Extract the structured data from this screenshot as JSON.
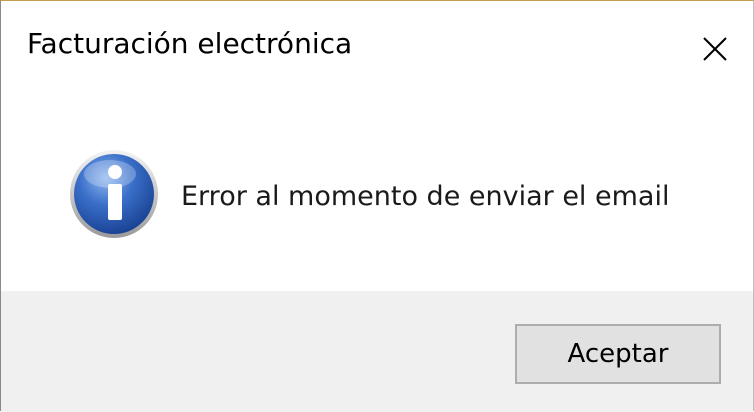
{
  "window": {
    "title": "Facturación electrónica",
    "close_icon": "close-icon"
  },
  "content": {
    "icon": "info-icon",
    "message": "Error al momento de enviar el email"
  },
  "footer": {
    "accept_label": "Aceptar"
  },
  "colors": {
    "icon_blue": "#2a5bb0",
    "footer_bg": "#f0f0f0",
    "button_bg": "#e1e1e1"
  }
}
